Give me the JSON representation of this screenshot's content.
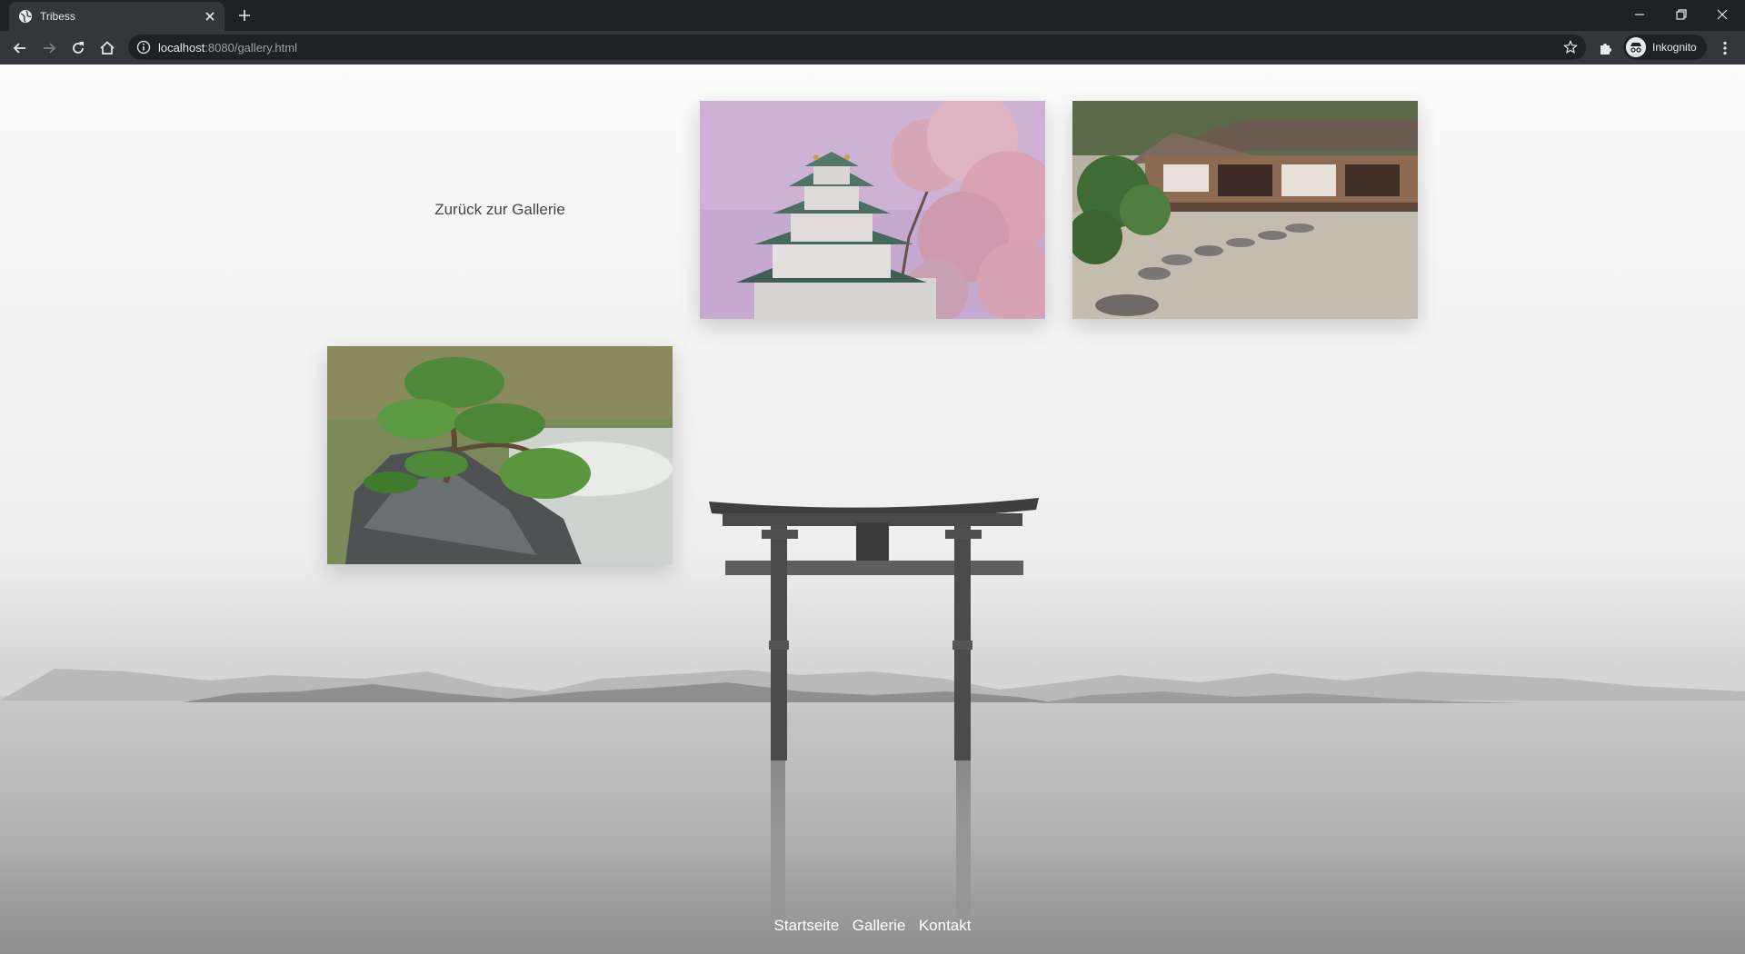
{
  "browser": {
    "tab_title": "Tribess",
    "url_host": "localhost",
    "url_path": ":8080/gallery.html",
    "profile_label": "Inkognito"
  },
  "page": {
    "back_link": "Zurück zur Gallerie",
    "gallery": [
      {
        "subject": "castle-with-cherry-blossoms"
      },
      {
        "subject": "zen-garden-house"
      },
      {
        "subject": "bonsai-tree"
      }
    ],
    "footer_nav": [
      "Startseite",
      "Gallerie",
      "Kontakt"
    ]
  }
}
